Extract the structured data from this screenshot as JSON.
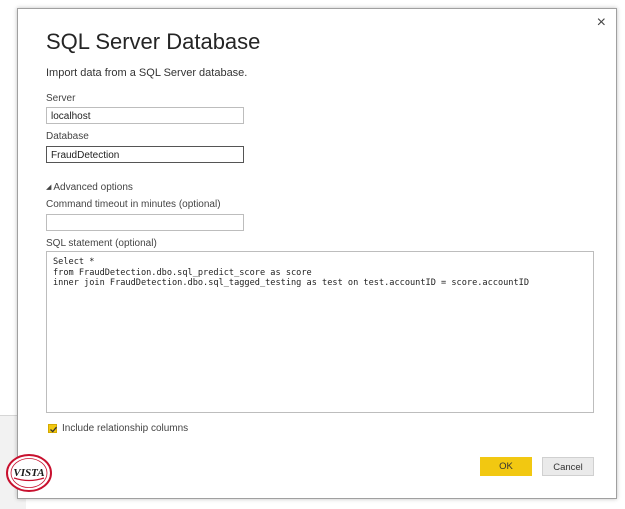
{
  "dialog": {
    "title": "SQL Server Database",
    "subtitle": "Import data from a SQL Server database.",
    "close_glyph": "×",
    "server_label": "Server",
    "server_value": "localhost",
    "database_label": "Database",
    "database_value": "FraudDetection",
    "advanced_label": "Advanced options",
    "timeout_label": "Command timeout in minutes (optional)",
    "timeout_value": "",
    "sql_label": "SQL statement (optional)",
    "sql_value": "Select *\nfrom FraudDetection.dbo.sql_predict_score as score\ninner join FraudDetection.dbo.sql_tagged_testing as test on test.accountID = score.accountID",
    "include_relationship_label": "Include relationship columns",
    "include_relationship_checked": true,
    "ok_label": "OK",
    "cancel_label": "Cancel"
  },
  "logo": {
    "text": "VISTA",
    "icon": "vista-logo"
  },
  "colors": {
    "accent": "#F2C811",
    "logo_red": "#C8102E"
  }
}
